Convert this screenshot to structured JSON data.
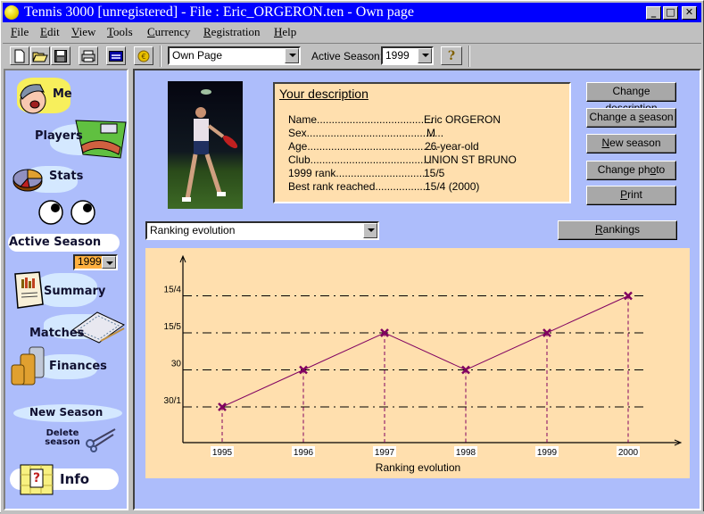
{
  "window": {
    "title": "Tennis 3000 [unregistered] - File : Eric_ORGERON.ten - Own page",
    "controls": [
      "_",
      "□",
      "✕"
    ]
  },
  "menubar": [
    {
      "label": "File",
      "accel": "F"
    },
    {
      "label": "Edit",
      "accel": "E"
    },
    {
      "label": "View",
      "accel": "V"
    },
    {
      "label": "Tools",
      "accel": "T"
    },
    {
      "label": "Currency",
      "accel": "C"
    },
    {
      "label": "Registration",
      "accel": "R"
    },
    {
      "label": "Help",
      "accel": "H"
    }
  ],
  "toolbar": {
    "buttons": [
      "new-file-icon",
      "open-folder-icon",
      "save-disk-icon",
      "print-icon",
      "window-icon",
      "currency-coin-icon"
    ],
    "page_select": "Own Page",
    "active_season_label": "Active Season:",
    "active_season_value": "1999",
    "help_label": "?"
  },
  "sidebar": {
    "items": [
      {
        "label": "Me",
        "icon": "me-cartoon-icon"
      },
      {
        "label": "Players",
        "icon": "handshake-icon"
      },
      {
        "label": "Stats",
        "icon": "pie-chart-icon"
      },
      {
        "label": "",
        "icon": "eyes-icon"
      },
      {
        "label": "Active Season",
        "icon": ""
      },
      {
        "label": "Summary",
        "icon": "summary-document-icon"
      },
      {
        "label": "Matches",
        "icon": "ledger-book-icon"
      },
      {
        "label": "Finances",
        "icon": "coin-stacks-icon"
      },
      {
        "label": "New Season",
        "icon": ""
      },
      {
        "label": "Delete season",
        "icon": "scissors-icon"
      },
      {
        "label": "Info",
        "icon": "info-question-icon"
      }
    ],
    "season_select": "1999"
  },
  "description": {
    "title": "Your description",
    "rows": [
      {
        "label": "Name.......................................",
        "value": "Eric ORGERON"
      },
      {
        "label": "Sex..............................................",
        "value": "M"
      },
      {
        "label": "Age............................................",
        "value": "26-year-old"
      },
      {
        "label": "Club.........................................",
        "value": "UNION ST BRUNO"
      },
      {
        "label": "1999 rank..............................",
        "value": "15/5"
      },
      {
        "label": "Best rank reached.................",
        "value": "15/4 (2000)"
      }
    ]
  },
  "actions": {
    "change_description": "Change description",
    "change_season": "Change a season",
    "new_season": "New season",
    "change_photo": "Change photo",
    "print": "Print",
    "rankings": "Rankings"
  },
  "chart_select": "Ranking evolution",
  "colors": {
    "window_bg": "#adbdfb",
    "panel_bg": "#ffdfae",
    "title_bar": "#0000ff",
    "series": "#800060"
  },
  "chart_data": {
    "type": "line",
    "title": "",
    "xlabel": "Ranking evolution",
    "ylabel": "",
    "categories": [
      "1995",
      "1996",
      "1997",
      "1998",
      "1999",
      "2000"
    ],
    "y_levels": [
      "30/1",
      "30",
      "15/5",
      "15/4"
    ],
    "series": [
      {
        "name": "Ranking",
        "values": [
          "30/1",
          "30",
          "15/5",
          "30",
          "15/5",
          "15/4"
        ]
      }
    ],
    "grid": true,
    "legend": "none"
  }
}
